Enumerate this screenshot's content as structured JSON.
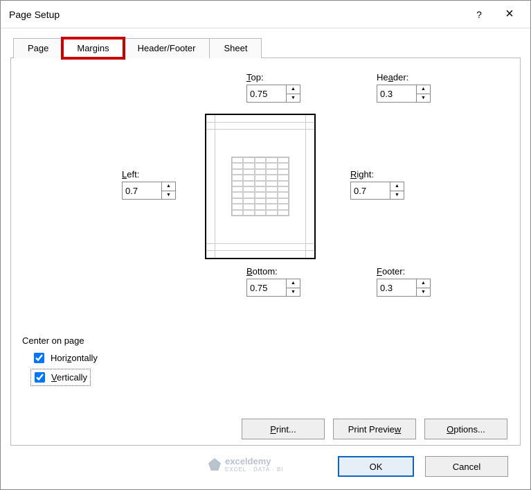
{
  "window": {
    "title": "Page Setup",
    "help": "?",
    "close": "×"
  },
  "tabs": {
    "page": "Page",
    "margins": "Margins",
    "header_footer": "Header/Footer",
    "sheet": "Sheet"
  },
  "margins": {
    "top_label": "Top:",
    "top_value": "0.75",
    "header_label": "Header:",
    "header_value": "0.3",
    "left_label": "Left:",
    "left_value": "0.7",
    "right_label": "Right:",
    "right_value": "0.7",
    "bottom_label": "Bottom:",
    "bottom_value": "0.75",
    "footer_label": "Footer:",
    "footer_value": "0.3"
  },
  "center": {
    "heading": "Center on page",
    "horizontally": "Horizontally",
    "vertically": "Vertically",
    "horizontally_checked": true,
    "vertically_checked": true
  },
  "buttons": {
    "print": "Print...",
    "print_preview": "Print Preview",
    "options": "Options...",
    "ok": "OK",
    "cancel": "Cancel"
  },
  "watermark": {
    "brand": "exceldemy",
    "tagline": "EXCEL · DATA · BI"
  }
}
